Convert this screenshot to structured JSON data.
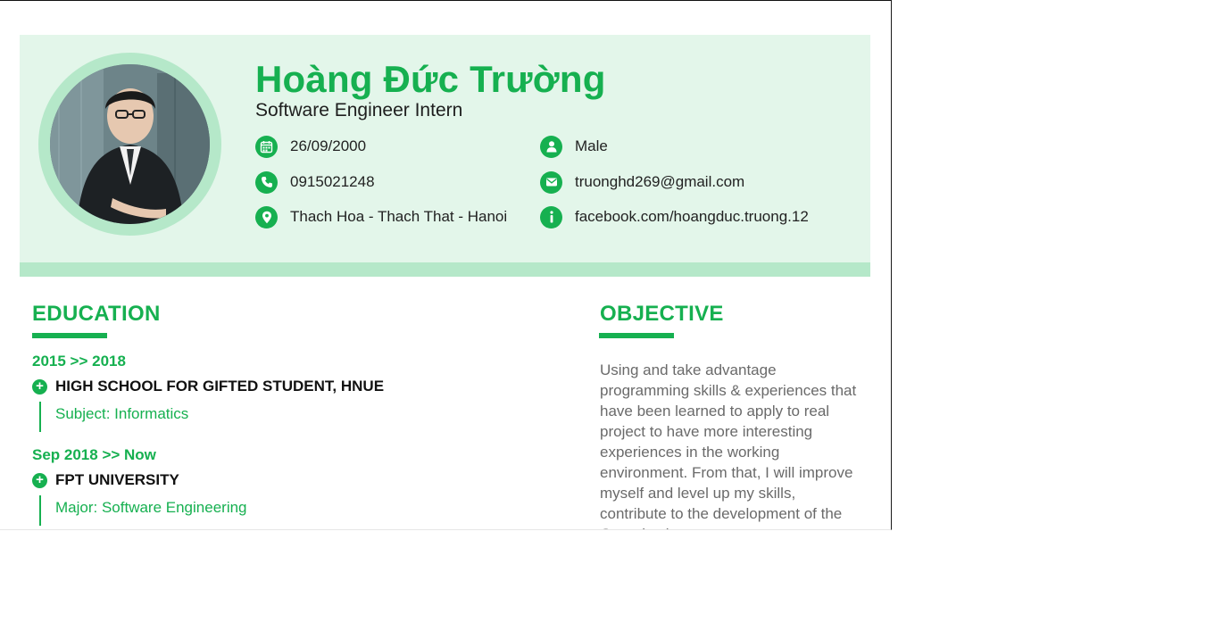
{
  "profile": {
    "name": "Hoàng Đức Trường",
    "role": "Software Engineer Intern",
    "dob": "26/09/2000",
    "gender": "Male",
    "phone": "0915021248",
    "email": "truonghd269@gmail.com",
    "address": "Thach Hoa - Thach That - Hanoi",
    "facebook": "facebook.com/hoangduc.truong.12"
  },
  "icons": {
    "dob": "calendar-icon",
    "gender": "user-icon",
    "phone": "phone-icon",
    "email": "envelope-icon",
    "address": "map-pin-icon",
    "facebook": "info-icon",
    "school": "plus-circle-icon"
  },
  "colors": {
    "accent": "#16b050",
    "header_bg": "#e3f6ea",
    "header_bar": "#b5e8c9",
    "body_text": "#6a6a6a"
  },
  "education": {
    "title": "EDUCATION",
    "items": [
      {
        "period": "2015  >>  2018",
        "school": "HIGH SCHOOL FOR GIFTED STUDENT, HNUE",
        "detail": "Subject: Informatics"
      },
      {
        "period": "Sep 2018  >>  Now",
        "school": "FPT UNIVERSITY",
        "detail": "Major: Software Engineering"
      }
    ]
  },
  "objective": {
    "title": "OBJECTIVE",
    "text": "Using and take advantage programming skills & experiences that have been learned to apply to real project to have more interesting experiences in the working environment. From that, I will improve myself and level up my skills, contribute to the development of the Organization"
  }
}
